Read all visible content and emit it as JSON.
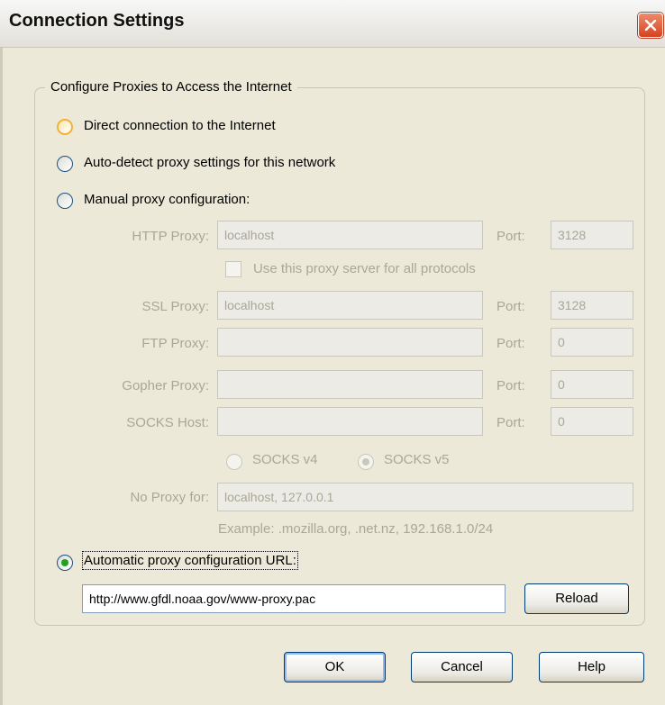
{
  "window": {
    "title": "Connection Settings"
  },
  "group": {
    "legend": "Configure Proxies to Access the Internet"
  },
  "options": {
    "direct": "Direct connection to the Internet",
    "autodetect": "Auto-detect proxy settings for this network",
    "manual": "Manual proxy configuration:",
    "pac": "Automatic proxy configuration URL:"
  },
  "proxies": {
    "http_label": "HTTP Proxy:",
    "http_value": "localhost",
    "http_port_label": "Port:",
    "http_port": "3128",
    "use_all_label": "Use this proxy server for all protocols",
    "ssl_label": "SSL Proxy:",
    "ssl_value": "localhost",
    "ssl_port_label": "Port:",
    "ssl_port": "3128",
    "ftp_label": "FTP Proxy:",
    "ftp_value": "",
    "ftp_port_label": "Port:",
    "ftp_port": "0",
    "gopher_label": "Gopher Proxy:",
    "gopher_value": "",
    "gopher_port_label": "Port:",
    "gopher_port": "0",
    "socks_label": "SOCKS Host:",
    "socks_value": "",
    "socks_port_label": "Port:",
    "socks_port": "0",
    "socks_v4": "SOCKS v4",
    "socks_v5": "SOCKS v5",
    "noproxy_label": "No Proxy for:",
    "noproxy_value": "localhost, 127.0.0.1",
    "example": "Example: .mozilla.org, .net.nz, 192.168.1.0/24"
  },
  "pac": {
    "url": "http://www.gfdl.noaa.gov/www-proxy.pac",
    "reload": "Reload"
  },
  "buttons": {
    "ok": "OK",
    "cancel": "Cancel",
    "help": "Help"
  },
  "colors": {
    "accent": "#21a121",
    "close": "#d6421f",
    "hover_ring": "#f3b135"
  }
}
